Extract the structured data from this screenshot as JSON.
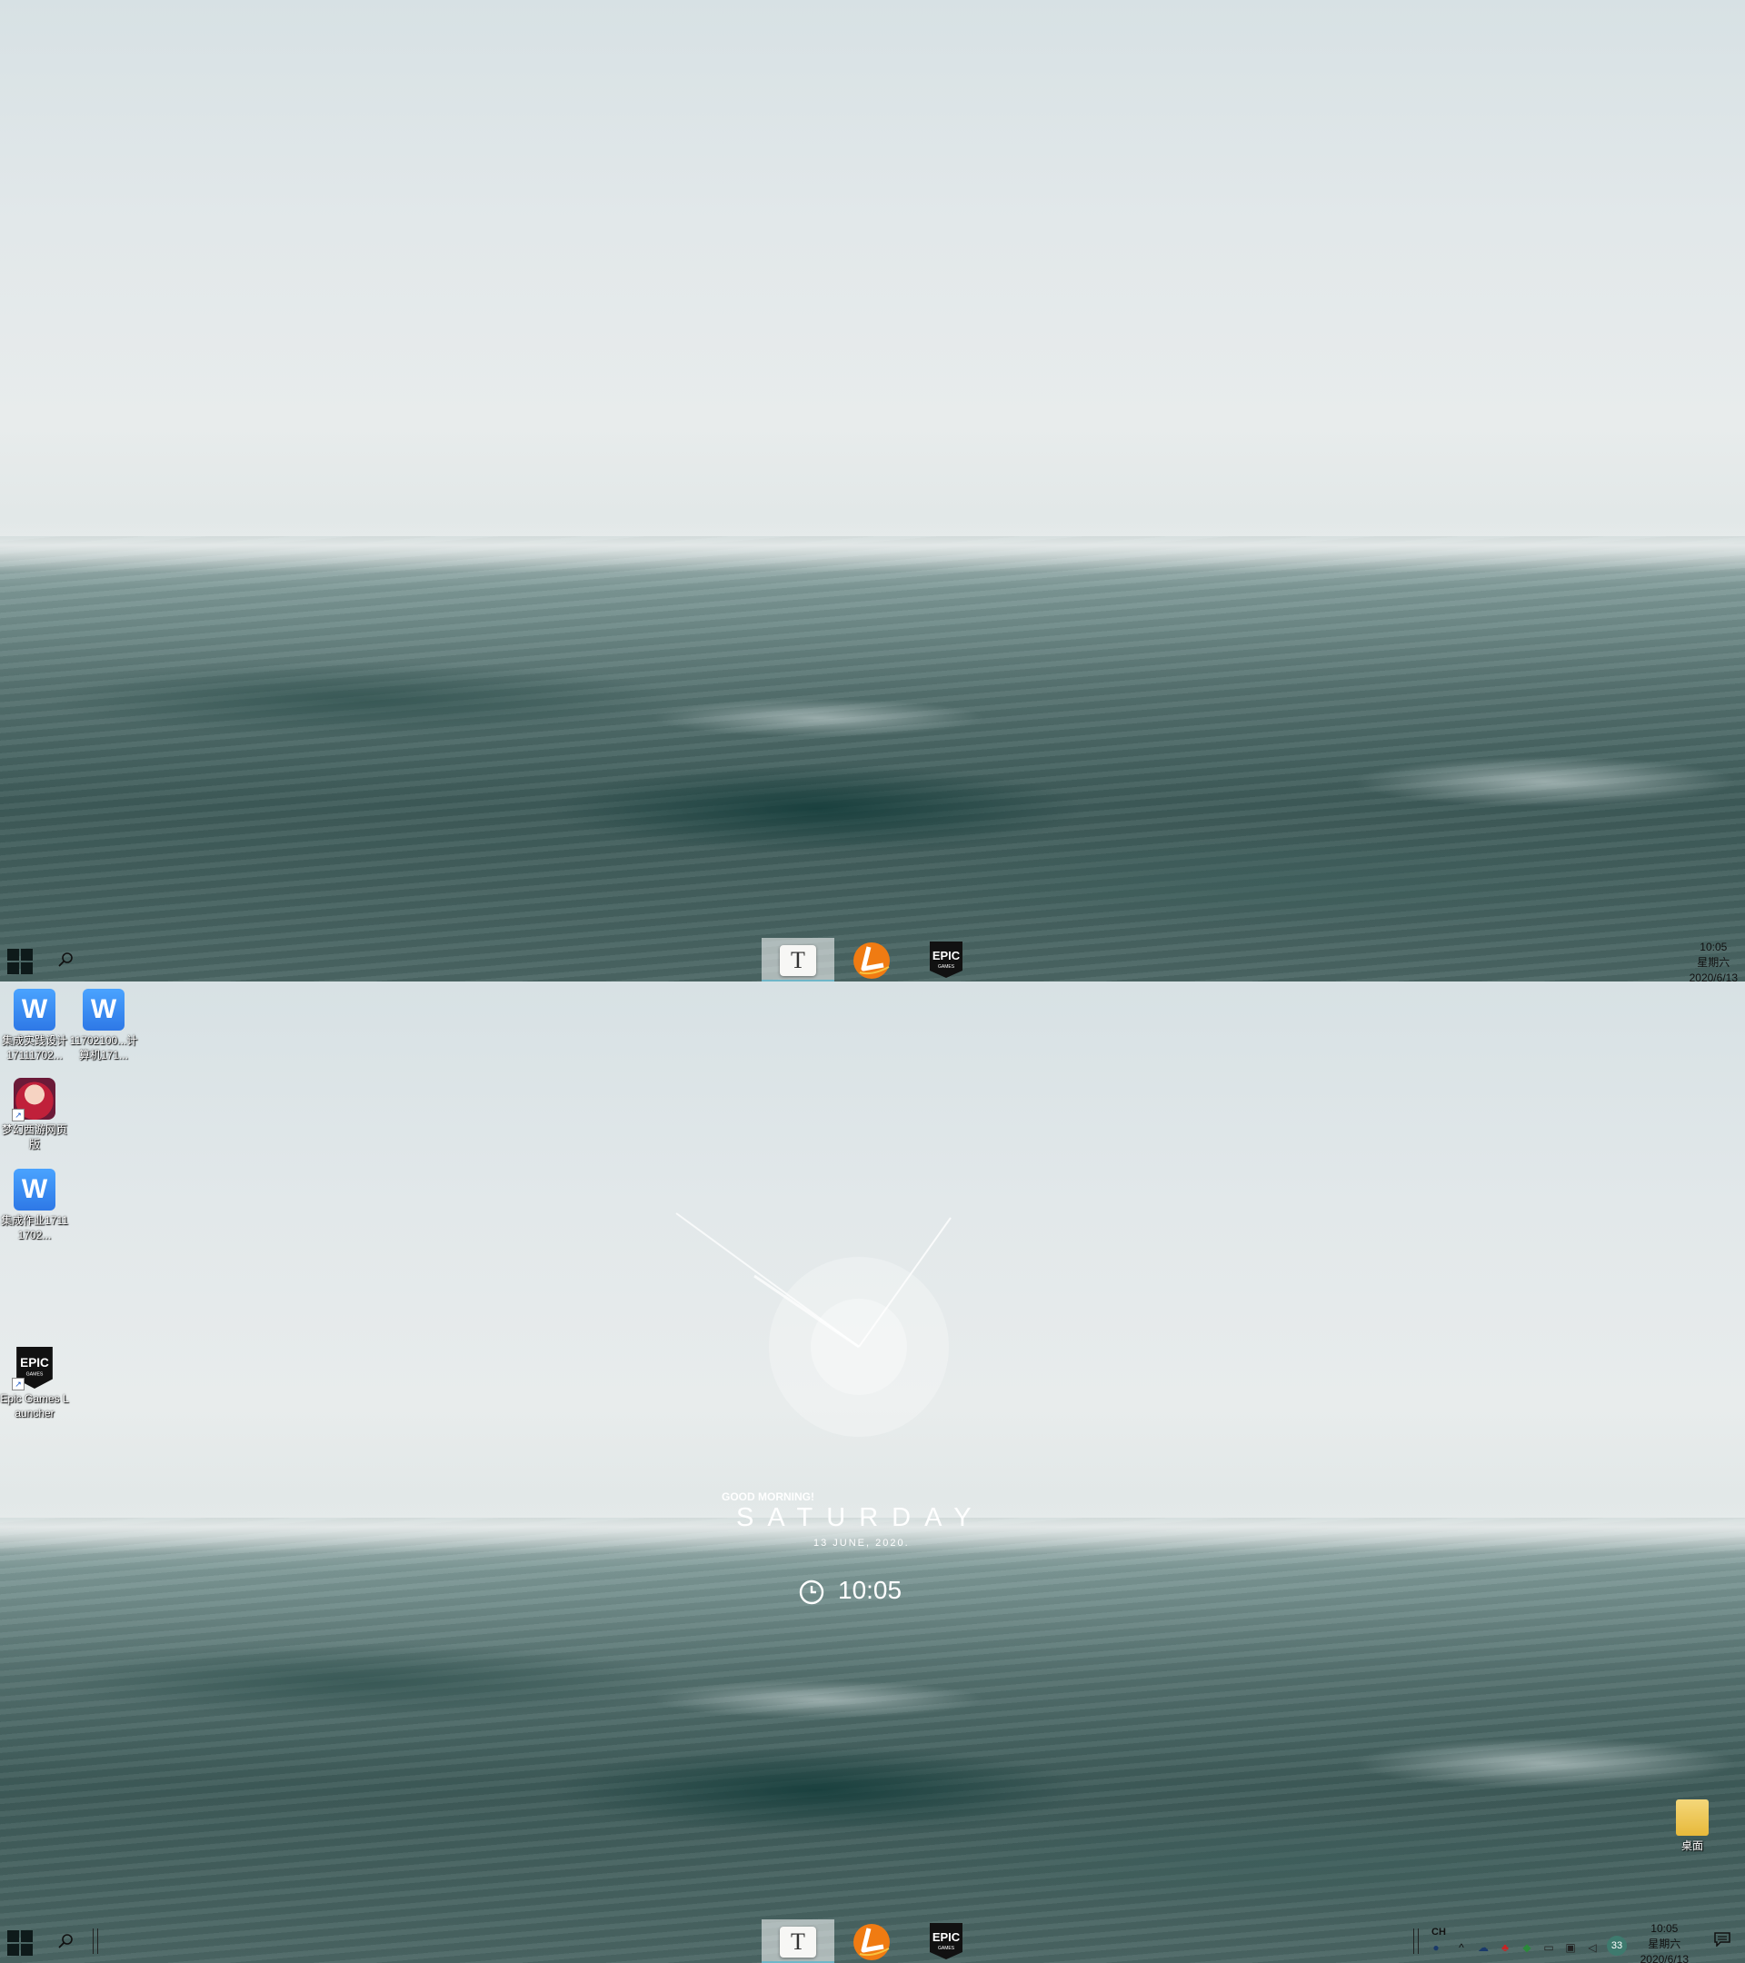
{
  "taskbar": {
    "pinned": [
      {
        "name": "Typora",
        "glyph": "T",
        "active": true
      },
      {
        "name": "Launcher",
        "glyph": "",
        "active": false
      },
      {
        "name": "Epic Games",
        "glyph_top": "EPIC",
        "glyph_bottom": "GAMES",
        "active": false
      }
    ],
    "clock": {
      "time": "10:05",
      "weekday": "星期六",
      "date": "2020/6/13"
    },
    "tray": {
      "ime": "CH",
      "badge": "33"
    }
  },
  "desktop": {
    "icons": [
      {
        "label": "集成实践设计17111702...",
        "glyph": "W"
      },
      {
        "label": "11702100...计算机171...",
        "glyph": "W"
      },
      {
        "label": "梦幻西游网页版",
        "glyph": ""
      },
      {
        "label": "集成作业17111702...",
        "glyph": "W"
      },
      {
        "label": "Epic Games Launcher",
        "glyph_top": "EPIC",
        "glyph_bottom": "GAMES"
      }
    ],
    "bottom_right_icon": {
      "label": "桌面"
    }
  },
  "widget": {
    "greeting": "GOOD MORNING!",
    "day": "SATURDAY",
    "date": "13 JUNE, 2020.",
    "time": "10:05"
  },
  "colors": {
    "accent_underline": "#6fb6c8",
    "wps_blue": "#2e78e6"
  }
}
